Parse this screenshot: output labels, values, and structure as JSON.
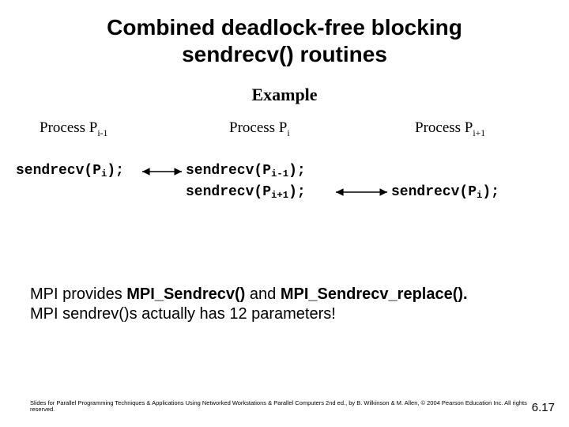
{
  "title_line1": "Combined deadlock-free blocking",
  "title_line2": "sendrecv() routines",
  "example_label": "Example",
  "procs": {
    "left_prefix": "Process P",
    "left_sub": "i-1",
    "mid_prefix": "Process P",
    "mid_sub": "i",
    "right_prefix": "Process P",
    "right_sub": "i+1"
  },
  "code": {
    "left_call": "sendrecv(P",
    "left_arg_sub": "i",
    "left_tail": ");",
    "mid1_call": "sendrecv(P",
    "mid1_arg_sub": "i-1",
    "mid1_tail": ");",
    "mid2_call": "sendrecv(P",
    "mid2_arg_sub": "i+1",
    "mid2_tail": ");",
    "right_call": "sendrecv(P",
    "right_arg_sub": "i",
    "right_tail": ");"
  },
  "body": {
    "line1_pre": "MPI provides ",
    "line1_b1": "MPI_Sendrecv()",
    "line1_mid": " and ",
    "line1_b2": "MPI_Sendrecv_replace().",
    "line2": "MPI sendrev()s actually has 12 parameters!"
  },
  "footer": "Slides for Parallel Programming Techniques & Applications Using Networked Workstations & Parallel Computers 2nd ed., by B. Wilkinson & M. Allen, © 2004 Pearson Education Inc. All rights reserved.",
  "pagenum": "6.17"
}
